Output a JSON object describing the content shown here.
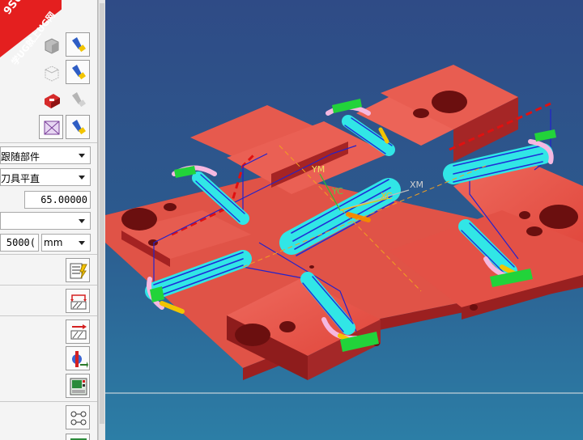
{
  "watermark": {
    "line1": "9SUG",
    "line2": "学UG就上UG网"
  },
  "panel": {
    "combo_follow": "跟随部件",
    "combo_tool_perp": "刀具平直",
    "value_field": "65.00000",
    "value_field2": "5000(",
    "unit": "mm"
  },
  "viewport": {
    "axis_labels": {
      "ym": "YM",
      "yc": "YC",
      "xc": "XC",
      "xm": "XM"
    }
  },
  "colors": {
    "mold_plate": "#e8584c",
    "mold_dark": "#8a1e1e",
    "toolpath": "#31e6e6",
    "toolpath_blue": "#1f2fd6",
    "background_top": "#2f4b86",
    "background_bottom": "#2c7ea6"
  }
}
